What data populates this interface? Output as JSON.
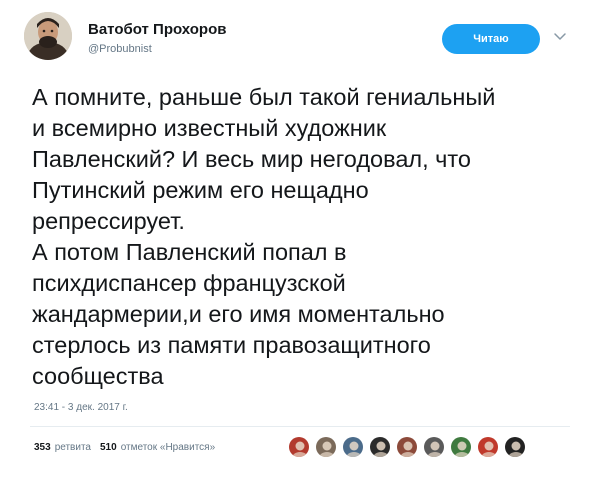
{
  "author": {
    "display_name": "Ватобот Прохоров",
    "handle": "@Probubnist",
    "avatar_icon": "profile-photo-icon"
  },
  "follow_button": {
    "label": "Читаю",
    "color": "#1da1f2"
  },
  "menu_icon": "chevron-down-icon",
  "tweet": {
    "lines": [
      "А помните, раньше был такой гениальный",
      "и всемирно известный художник",
      "Павленский? И весь мир негодовал, что",
      "Путинский режим его нещадно",
      "репрессирует.",
      "А потом Павленский попал в",
      "психдиспансер французской",
      "жандармерии,и его имя моментально",
      "стерлось из памяти правозащитного",
      "сообщества"
    ],
    "timestamp": "23:41 - 3 дек. 2017 г."
  },
  "stats": {
    "retweets_count": "353",
    "retweets_label": "ретвита",
    "likes_count": "510",
    "likes_label": "отметок «Нравится»"
  },
  "likers": [
    {
      "icon": "liker-avatar-icon",
      "color": "#b23a2e"
    },
    {
      "icon": "liker-avatar-icon",
      "color": "#7b6a5a"
    },
    {
      "icon": "liker-avatar-icon",
      "color": "#4b6b8a"
    },
    {
      "icon": "liker-avatar-icon",
      "color": "#2b2b2b"
    },
    {
      "icon": "liker-avatar-icon",
      "color": "#8c4a3a"
    },
    {
      "icon": "liker-avatar-icon",
      "color": "#5a5a5a"
    },
    {
      "icon": "liker-avatar-icon",
      "color": "#3f7a3f"
    },
    {
      "icon": "liker-avatar-icon",
      "color": "#c0392b"
    },
    {
      "icon": "liker-avatar-icon",
      "color": "#222222"
    }
  ]
}
